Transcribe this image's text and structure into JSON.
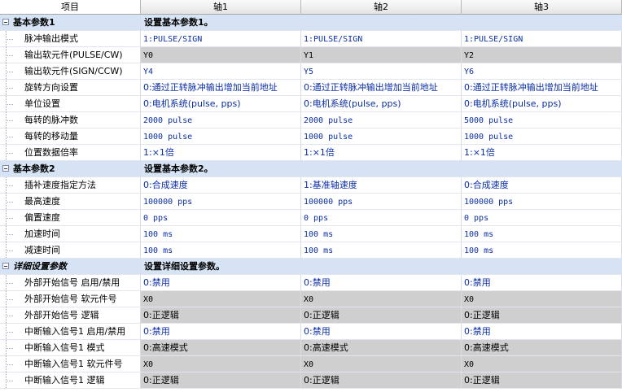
{
  "header": {
    "col_item": "项目",
    "col_axis1": "轴1",
    "col_axis2": "轴2",
    "col_axis3": "轴3"
  },
  "sections": [
    {
      "title": "基本参数1",
      "description": "设置基本参数1。",
      "rows": [
        {
          "label": "脉冲输出模式",
          "v1": "1:PULSE/SIGN",
          "v2": "1:PULSE/SIGN",
          "v3": "1:PULSE/SIGN",
          "readonly": false,
          "mono": true
        },
        {
          "label": "输出软元件(PULSE/CW)",
          "v1": "Y0",
          "v2": "Y1",
          "v3": "Y2",
          "readonly": true,
          "mono": true
        },
        {
          "label": "输出软元件(SIGN/CCW)",
          "v1": "Y4",
          "v2": "Y5",
          "v3": "Y6",
          "readonly": false,
          "mono": true
        },
        {
          "label": "旋转方向设置",
          "v1": "0:通过正转脉冲输出增加当前地址",
          "v2": "0:通过正转脉冲输出增加当前地址",
          "v3": "0:通过正转脉冲输出增加当前地址",
          "readonly": false,
          "mono": false
        },
        {
          "label": "单位设置",
          "v1": "0:电机系统(pulse, pps)",
          "v2": "0:电机系统(pulse, pps)",
          "v3": "0:电机系统(pulse, pps)",
          "readonly": false,
          "mono": false
        },
        {
          "label": "每转的脉冲数",
          "v1": "2000 pulse",
          "v2": "2000 pulse",
          "v3": "5000 pulse",
          "readonly": false,
          "mono": true
        },
        {
          "label": "每转的移动量",
          "v1": "1000 pulse",
          "v2": "1000 pulse",
          "v3": "1000 pulse",
          "readonly": false,
          "mono": true
        },
        {
          "label": "位置数据倍率",
          "v1": "1:×1倍",
          "v2": "1:×1倍",
          "v3": "1:×1倍",
          "readonly": false,
          "mono": false
        }
      ]
    },
    {
      "title": "基本参数2",
      "description": "设置基本参数2。",
      "rows": [
        {
          "label": "插补速度指定方法",
          "v1": "0:合成速度",
          "v2": "1:基准轴速度",
          "v3": "0:合成速度",
          "readonly": false,
          "mono": false
        },
        {
          "label": "最高速度",
          "v1": "100000 pps",
          "v2": "100000 pps",
          "v3": "100000 pps",
          "readonly": false,
          "mono": true
        },
        {
          "label": "偏置速度",
          "v1": "0 pps",
          "v2": "0 pps",
          "v3": "0 pps",
          "readonly": false,
          "mono": true
        },
        {
          "label": "加速时间",
          "v1": "100 ms",
          "v2": "100 ms",
          "v3": "100 ms",
          "readonly": false,
          "mono": true
        },
        {
          "label": "减速时间",
          "v1": "100 ms",
          "v2": "100 ms",
          "v3": "100 ms",
          "readonly": false,
          "mono": true
        }
      ]
    },
    {
      "title": "详细设置参数",
      "description": "设置详细设置参数。",
      "italic": true,
      "rows": [
        {
          "label": "外部开始信号 启用/禁用",
          "v1": "0:禁用",
          "v2": "0:禁用",
          "v3": "0:禁用",
          "readonly": false,
          "mono": false
        },
        {
          "label": "外部开始信号  软元件号",
          "v1": "X0",
          "v2": "X0",
          "v3": "X0",
          "readonly": true,
          "mono": true
        },
        {
          "label": "外部开始信号  逻辑",
          "v1": "0:正逻辑",
          "v2": "0:正逻辑",
          "v3": "0:正逻辑",
          "readonly": true,
          "mono": false
        },
        {
          "label": "中断输入信号1 启用/禁用",
          "v1": "0:禁用",
          "v2": "0:禁用",
          "v3": "0:禁用",
          "readonly": false,
          "mono": false
        },
        {
          "label": "中断输入信号1  模式",
          "v1": "0:高速模式",
          "v2": "0:高速模式",
          "v3": "0:高速模式",
          "readonly": true,
          "mono": false
        },
        {
          "label": "中断输入信号1  软元件号",
          "v1": "X0",
          "v2": "X0",
          "v3": "X0",
          "readonly": true,
          "mono": true
        },
        {
          "label": "中断输入信号1 逻辑",
          "v1": "0:正逻辑",
          "v2": "0:正逻辑",
          "v3": "0:正逻辑",
          "readonly": true,
          "mono": false
        }
      ]
    }
  ]
}
